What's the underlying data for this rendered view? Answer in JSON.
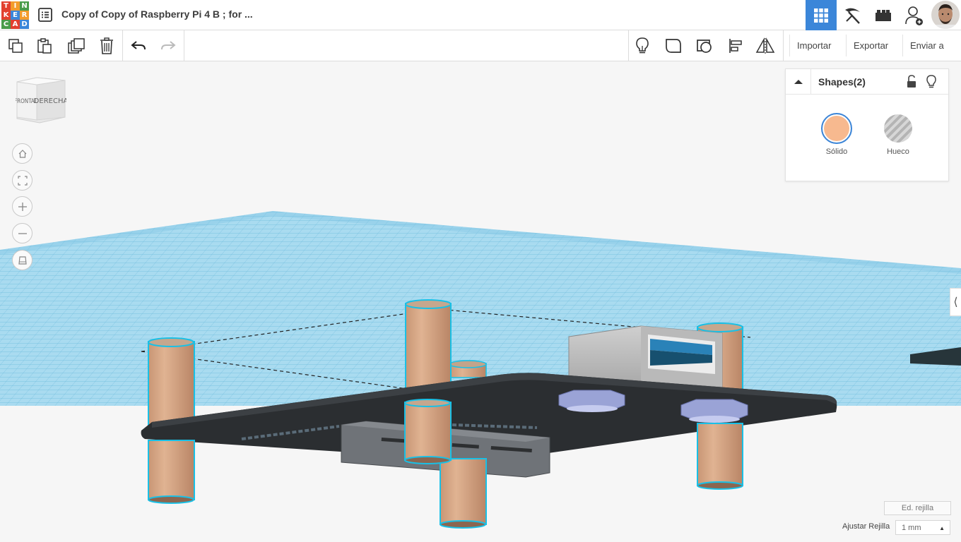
{
  "app": {
    "logo_letters": [
      "T",
      "I",
      "N",
      "K",
      "E",
      "R",
      "C",
      "A",
      "D"
    ],
    "logo_colors": [
      "#e2402f",
      "#f39c2c",
      "#4a9c4a",
      "#e2402f",
      "#3b86d9",
      "#f39c2c",
      "#4a9c4a",
      "#e2402f",
      "#3b86d9"
    ],
    "doc_title": "Copy of Copy of Raspberry Pi 4 B ; for ..."
  },
  "header": {
    "right_buttons": [
      {
        "name": "3d-design-view-icon",
        "active": true
      },
      {
        "name": "codeblocks-pickaxe-icon",
        "active": false
      },
      {
        "name": "bricks-view-icon",
        "active": false
      },
      {
        "name": "invite-user-icon",
        "active": false
      }
    ]
  },
  "toolbar": {
    "import_label": "Importar",
    "export_label": "Exportar",
    "send_label": "Enviar a"
  },
  "viewcube": {
    "front": "FRONTAL",
    "right": "DERECHA"
  },
  "panel": {
    "title": "Shapes(2)",
    "solid_label": "Sólido",
    "hole_label": "Hueco",
    "solid_color": "#f7b98f",
    "accent_color": "#3b86d9"
  },
  "footer": {
    "edit_grid_label": "Ed. rejilla",
    "snap_label": "Ajustar Rejilla",
    "snap_value": "1 mm"
  },
  "colors": {
    "grid": "#a8d9ef",
    "grid_line": "#5fb3d6",
    "board": "#2a2d30",
    "standoff": "#d4a482",
    "selection": "#19c0e6",
    "nut": "#9aa3d6",
    "connector": "#b0b0b0"
  }
}
